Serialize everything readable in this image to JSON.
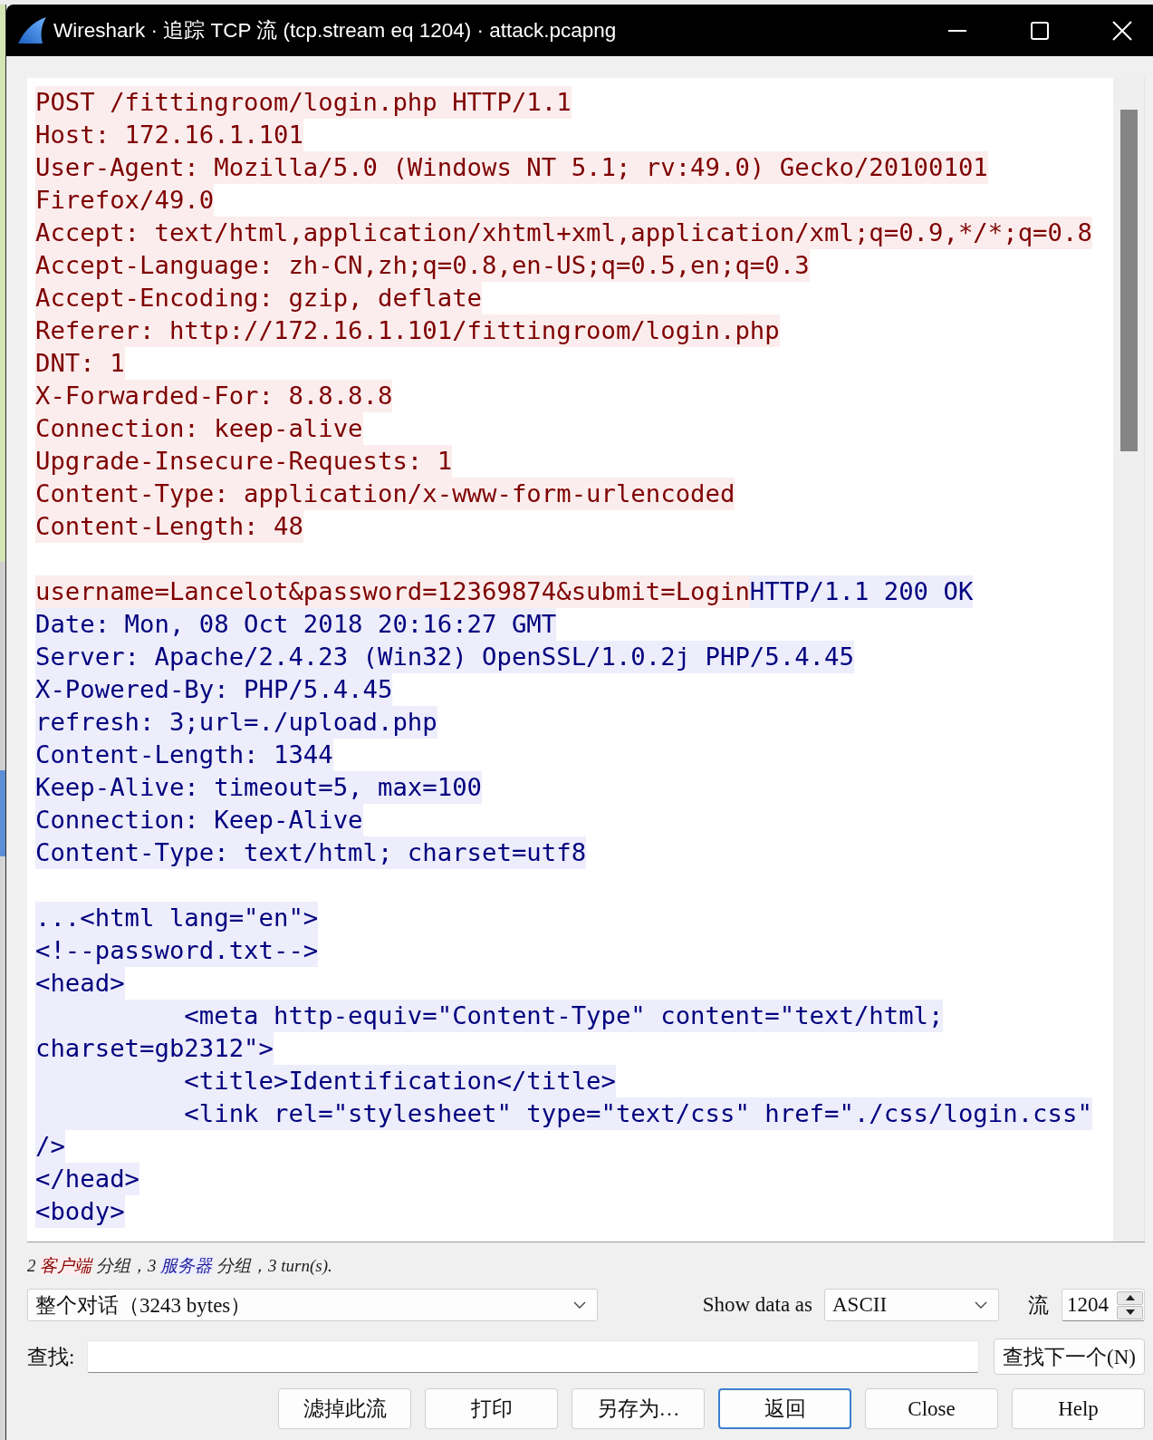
{
  "window": {
    "title": "Wireshark · 追踪 TCP 流 (tcp.stream eq 1204) · attack.pcapng"
  },
  "stream": {
    "paragraphs": [
      {
        "lines": [
          {
            "segments": [
              {
                "kind": "client",
                "text": "POST /fittingroom/login.php HTTP/1.1"
              }
            ]
          },
          {
            "segments": [
              {
                "kind": "client",
                "text": "Host: 172.16.1.101"
              }
            ]
          },
          {
            "segments": [
              {
                "kind": "client",
                "text": "User-Agent: Mozilla/5.0 (Windows NT 5.1; rv:49.0) Gecko/20100101"
              }
            ]
          },
          {
            "segments": [
              {
                "kind": "client",
                "text": "Firefox/49.0"
              }
            ]
          },
          {
            "segments": [
              {
                "kind": "client",
                "text": "Accept: text/html,application/xhtml+xml,application/xml;q=0.9,*/*;q=0.8"
              }
            ]
          },
          {
            "segments": [
              {
                "kind": "client",
                "text": "Accept-Language: zh-CN,zh;q=0.8,en-US;q=0.5,en;q=0.3"
              }
            ]
          },
          {
            "segments": [
              {
                "kind": "client",
                "text": "Accept-Encoding: gzip, deflate"
              }
            ]
          },
          {
            "segments": [
              {
                "kind": "client",
                "text": "Referer: http://172.16.1.101/fittingroom/login.php"
              }
            ]
          },
          {
            "segments": [
              {
                "kind": "client",
                "text": "DNT: 1"
              }
            ]
          },
          {
            "segments": [
              {
                "kind": "client",
                "text": "X-Forwarded-For: 8.8.8.8"
              }
            ]
          },
          {
            "segments": [
              {
                "kind": "client",
                "text": "Connection: keep-alive"
              }
            ]
          },
          {
            "segments": [
              {
                "kind": "client",
                "text": "Upgrade-Insecure-Requests: 1"
              }
            ]
          },
          {
            "segments": [
              {
                "kind": "client",
                "text": "Content-Type: application/x-www-form-urlencoded"
              }
            ]
          },
          {
            "segments": [
              {
                "kind": "client",
                "text": "Content-Length: 48"
              }
            ]
          }
        ]
      },
      {
        "lines": [
          {
            "segments": [
              {
                "kind": "client",
                "text": "username=Lancelot&password=12369874&submit=Login"
              },
              {
                "kind": "server",
                "text": "HTTP/1.1 200 OK"
              }
            ]
          },
          {
            "segments": [
              {
                "kind": "server",
                "text": "Date: Mon, 08 Oct 2018 20:16:27 GMT"
              }
            ]
          },
          {
            "segments": [
              {
                "kind": "server",
                "text": "Server: Apache/2.4.23 (Win32) OpenSSL/1.0.2j PHP/5.4.45"
              }
            ]
          },
          {
            "segments": [
              {
                "kind": "server",
                "text": "X-Powered-By: PHP/5.4.45"
              }
            ]
          },
          {
            "segments": [
              {
                "kind": "server",
                "text": "refresh: 3;url=./upload.php"
              }
            ]
          },
          {
            "segments": [
              {
                "kind": "server",
                "text": "Content-Length: 1344"
              }
            ]
          },
          {
            "segments": [
              {
                "kind": "server",
                "text": "Keep-Alive: timeout=5, max=100"
              }
            ]
          },
          {
            "segments": [
              {
                "kind": "server",
                "text": "Connection: Keep-Alive"
              }
            ]
          },
          {
            "segments": [
              {
                "kind": "server",
                "text": "Content-Type: text/html; charset=utf8"
              }
            ]
          }
        ]
      },
      {
        "lines": [
          {
            "segments": [
              {
                "kind": "server",
                "text": "...<html lang=\"en\">"
              }
            ]
          },
          {
            "segments": [
              {
                "kind": "server",
                "text": "<!--password.txt-->"
              }
            ]
          },
          {
            "segments": [
              {
                "kind": "server",
                "text": "<head>"
              }
            ]
          },
          {
            "segments": [
              {
                "kind": "server",
                "text": "\t<meta http-equiv=\"Content-Type\" content=\"text/html;"
              }
            ]
          },
          {
            "segments": [
              {
                "kind": "server",
                "text": "charset=gb2312\">"
              }
            ]
          },
          {
            "segments": [
              {
                "kind": "server",
                "text": "\t<title>Identification</title>"
              }
            ]
          },
          {
            "segments": [
              {
                "kind": "server",
                "text": "\t<link rel=\"stylesheet\" type=\"text/css\" href=\"./css/login.css\""
              }
            ]
          },
          {
            "segments": [
              {
                "kind": "server",
                "text": "/>"
              }
            ]
          },
          {
            "segments": [
              {
                "kind": "server",
                "text": "</head>"
              }
            ]
          },
          {
            "segments": [
              {
                "kind": "server",
                "text": "<body>"
              }
            ]
          }
        ]
      }
    ]
  },
  "summary": {
    "segments": [
      {
        "kind": "plain",
        "text": "2 "
      },
      {
        "kind": "client",
        "text": "客户端"
      },
      {
        "kind": "plain",
        "text": " 分组，3 "
      },
      {
        "kind": "server",
        "text": "服务器"
      },
      {
        "kind": "plain",
        "text": " 分组，3 turn(s)."
      }
    ]
  },
  "conversation_select": {
    "value": "整个对话（3243 bytes）"
  },
  "show_data_as": {
    "label": "Show data as",
    "value": "ASCII"
  },
  "stream_index": {
    "label": "流",
    "value": "1204"
  },
  "find": {
    "label": "查找:",
    "button": "查找下一个(N)"
  },
  "buttons": [
    {
      "label": "滤掉此流",
      "focused": false
    },
    {
      "label": "打印",
      "focused": false
    },
    {
      "label": "另存为…",
      "focused": false
    },
    {
      "label": "返回",
      "focused": true
    },
    {
      "label": "Close",
      "focused": false
    },
    {
      "label": "Help",
      "focused": false
    }
  ]
}
